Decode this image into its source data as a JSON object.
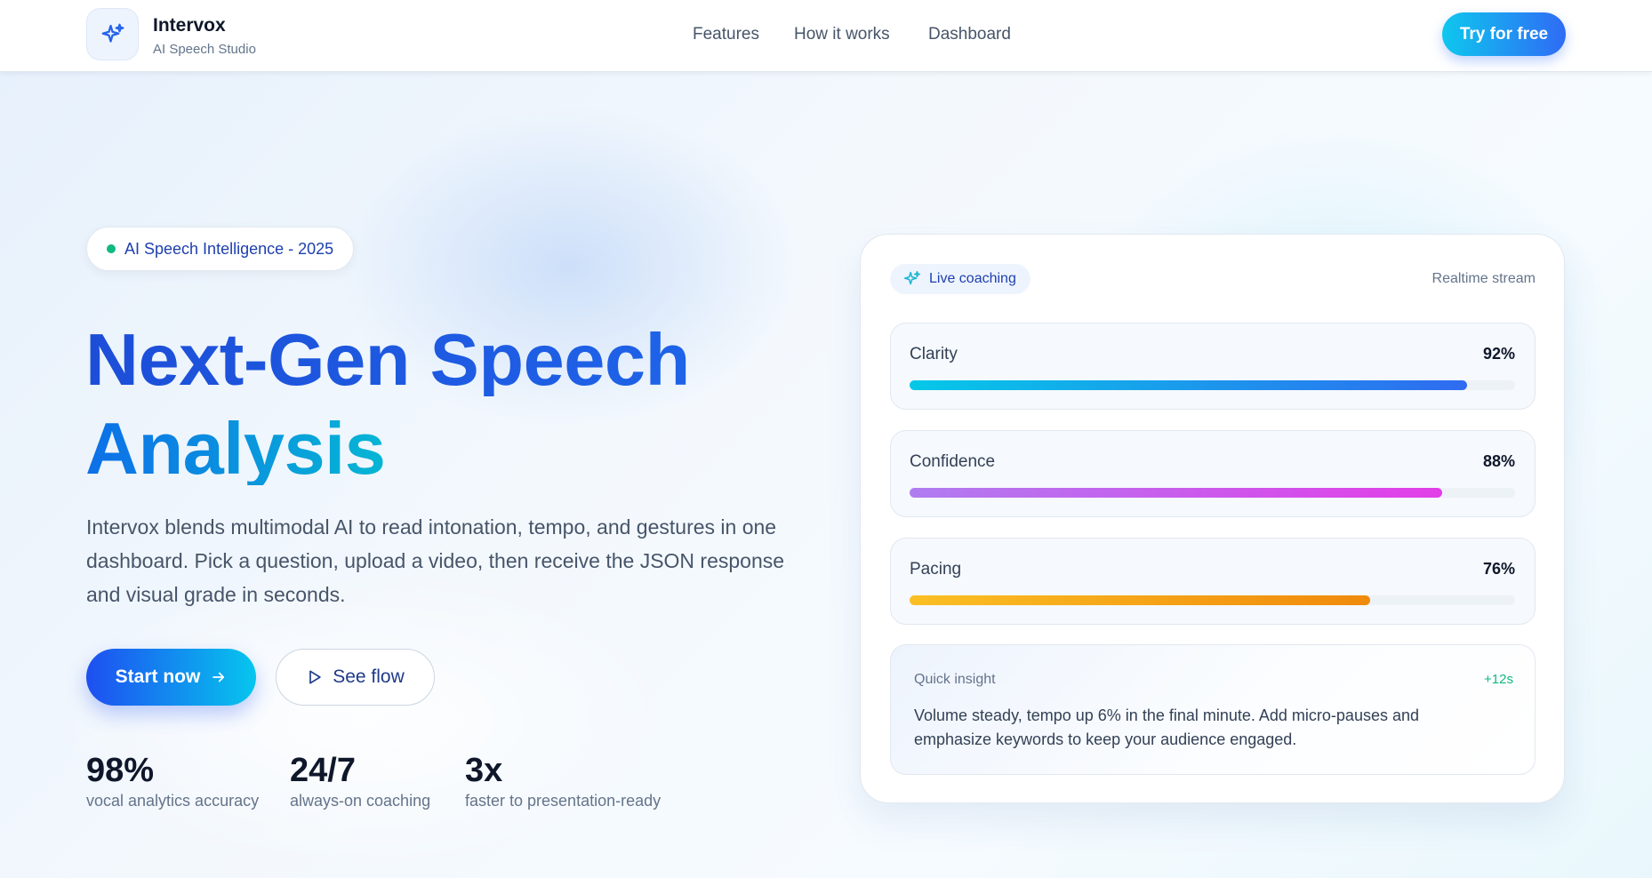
{
  "header": {
    "brand_name": "Intervox",
    "brand_tagline": "AI Speech Studio",
    "logo_icon": "sparkles-icon",
    "nav": [
      "Features",
      "How it works",
      "Dashboard"
    ],
    "cta_label": "Try for free"
  },
  "hero": {
    "badge": "AI Speech Intelligence - 2025",
    "title_line1": "Next-Gen Speech",
    "title_line2": "Analysis",
    "description": "Intervox blends multimodal AI to read intonation, tempo, and gestures in one dashboard. Pick a question, upload a video, then receive the JSON response and visual grade in seconds.",
    "primary_button": "Start now",
    "primary_icon": "arrow-right-icon",
    "secondary_button": "See flow",
    "secondary_icon": "play-icon",
    "stats": [
      {
        "value": "98%",
        "label": "vocal analytics accuracy"
      },
      {
        "value": "24/7",
        "label": "always-on coaching"
      },
      {
        "value": "3x",
        "label": "faster to presentation-ready"
      }
    ]
  },
  "coaching_card": {
    "badge": "Live coaching",
    "badge_icon": "sparkles-icon",
    "stream_label": "Realtime stream",
    "metrics": [
      {
        "label": "Clarity",
        "value_text": "92%",
        "value": 0.92,
        "colors": [
          "#06c8e8",
          "#2f6bf0"
        ]
      },
      {
        "label": "Confidence",
        "value_text": "88%",
        "value": 0.88,
        "colors": [
          "#b07cf0",
          "#e23ee8"
        ]
      },
      {
        "label": "Pacing",
        "value_text": "76%",
        "value": 0.76,
        "colors": [
          "#fbbf24",
          "#f08a0c"
        ]
      }
    ],
    "insight": {
      "label": "Quick insight",
      "time": "+12s",
      "text": "Volume steady, tempo up 6% in the final minute. Add micro-pauses and emphasize keywords to keep your audience engaged."
    }
  },
  "colors": {
    "primary": "#1d4ed8",
    "accent": "#06b6d4",
    "success": "#10b981"
  }
}
